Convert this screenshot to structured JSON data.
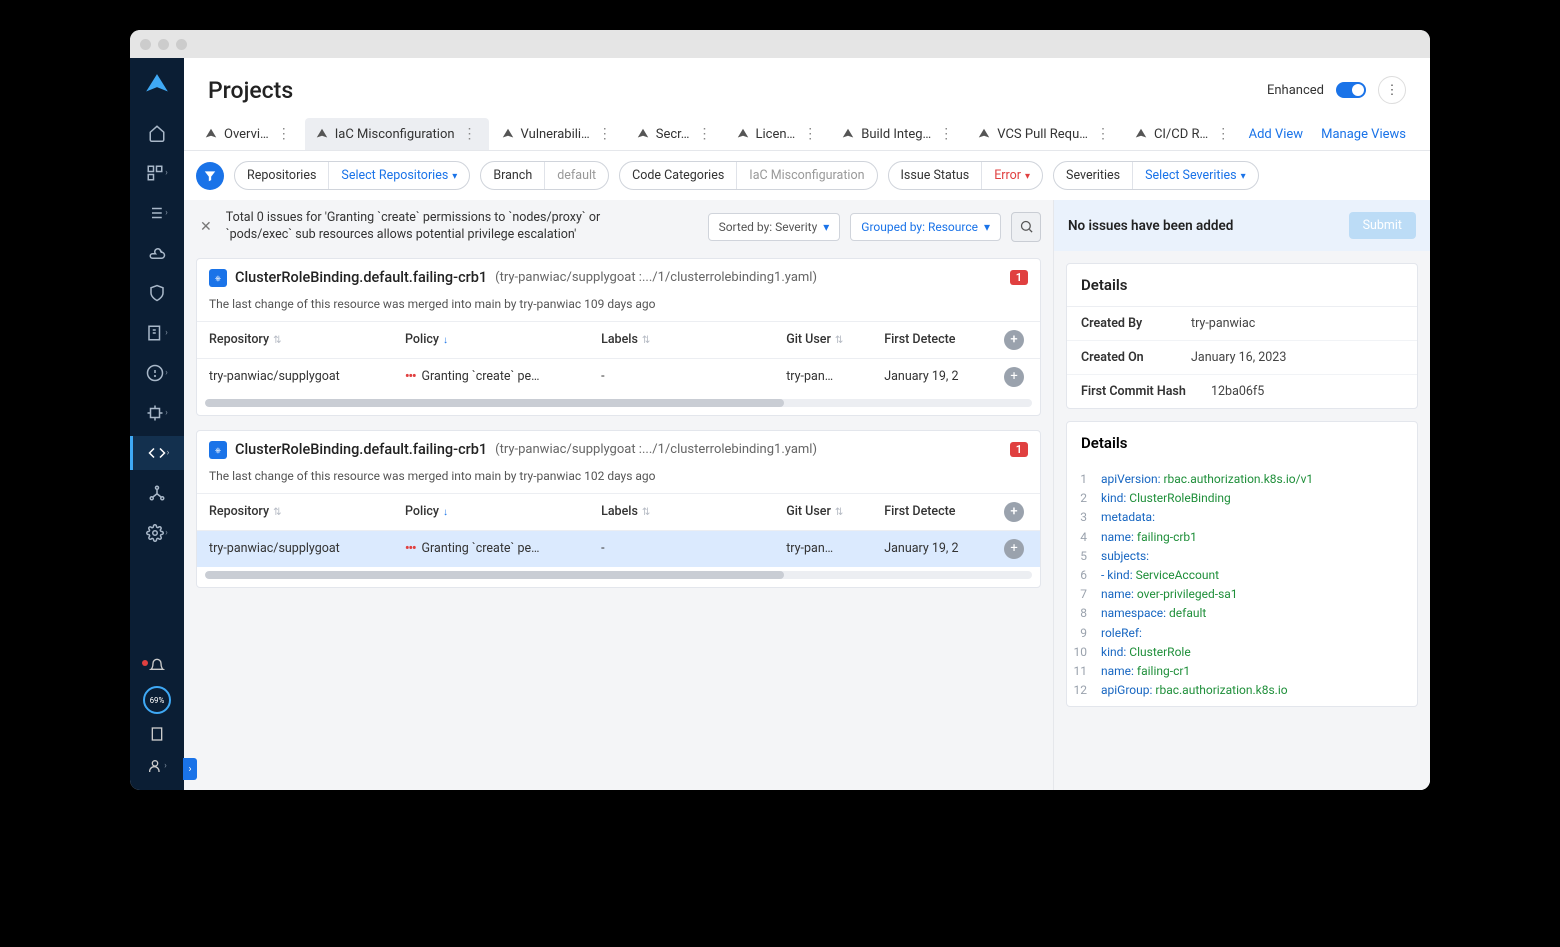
{
  "page": {
    "title": "Projects"
  },
  "header": {
    "enhanced_label": "Enhanced",
    "add_view": "Add View",
    "manage_views": "Manage Views"
  },
  "tabs": [
    {
      "label": "Overvi…",
      "active": false
    },
    {
      "label": "IaC Misconfiguration",
      "active": true
    },
    {
      "label": "Vulnerabili…",
      "active": false
    },
    {
      "label": "Secr…",
      "active": false
    },
    {
      "label": "Licen…",
      "active": false
    },
    {
      "label": "Build Integ…",
      "active": false
    },
    {
      "label": "VCS Pull Requ…",
      "active": false
    },
    {
      "label": "CI/CD R…",
      "active": false
    }
  ],
  "filters": {
    "repos_label": "Repositories",
    "repos_select": "Select Repositories",
    "branch_label": "Branch",
    "branch_value": "default",
    "codecat_label": "Code Categories",
    "codecat_value": "IaC Misconfiguration",
    "status_label": "Issue Status",
    "status_value": "Error",
    "sev_label": "Severities",
    "sev_select": "Select Severities"
  },
  "issues_bar": {
    "summary": "Total 0 issues for 'Granting `create` permissions to `nodes/proxy` or `pods/exec` sub resources allows potential privilege escalation'",
    "sorted_by": "Sorted by: Severity",
    "grouped_by": "Grouped by: Resource"
  },
  "table_headers": {
    "repository": "Repository",
    "policy": "Policy",
    "labels": "Labels",
    "git_user": "Git User",
    "first_detected": "First Detecte"
  },
  "cards": [
    {
      "title": "ClusterRoleBinding.default.failing-crb1",
      "subtitle": "(try-panwiac/supplygoat :.../1/clusterrolebinding1.yaml)",
      "badge": "1",
      "note": "The last change of this resource was merged into main by try-panwiac 109 days ago",
      "row": {
        "repo": "try-panwiac/supplygoat",
        "policy": "Granting `create` pe…",
        "labels": "-",
        "user": "try-pan…",
        "detected": "January 19, 2"
      },
      "highlighted": false
    },
    {
      "title": "ClusterRoleBinding.default.failing-crb1",
      "subtitle": "(try-panwiac/supplygoat :.../1/clusterrolebinding1.yaml)",
      "badge": "1",
      "note": "The last change of this resource was merged into main by try-panwiac 102 days ago",
      "row": {
        "repo": "try-panwiac/supplygoat",
        "policy": "Granting `create` pe…",
        "labels": "-",
        "user": "try-pan…",
        "detected": "January 19, 2"
      },
      "highlighted": true
    }
  ],
  "details": {
    "no_issues": "No issues have been added",
    "submit": "Submit",
    "heading": "Details",
    "created_by_k": "Created By",
    "created_by_v": "try-panwiac",
    "created_on_k": "Created On",
    "created_on_v": "January 16, 2023",
    "hash_k": "First Commit Hash",
    "hash_v": "12ba06f5",
    "code_heading": "Details",
    "code": [
      {
        "n": "1",
        "k": "apiVersion:",
        "v": " rbac.authorization.k8s.io/v1"
      },
      {
        "n": "2",
        "k": "kind:",
        "v": " ClusterRoleBinding"
      },
      {
        "n": "3",
        "k": "metadata:",
        "v": ""
      },
      {
        "n": "4",
        "k": "  name:",
        "v": " failing-crb1"
      },
      {
        "n": "5",
        "k": "subjects:",
        "v": ""
      },
      {
        "n": "6",
        "k": "- kind:",
        "v": " ServiceAccount"
      },
      {
        "n": "7",
        "k": "  name:",
        "v": " over-privileged-sa1"
      },
      {
        "n": "8",
        "k": "  namespace:",
        "v": " default"
      },
      {
        "n": "9",
        "k": "roleRef:",
        "v": ""
      },
      {
        "n": "10",
        "k": "  kind:",
        "v": " ClusterRole"
      },
      {
        "n": "11",
        "k": "  name:",
        "v": " failing-cr1"
      },
      {
        "n": "12",
        "k": "  apiGroup:",
        "v": " rbac.authorization.k8s.io"
      }
    ]
  },
  "gauge": "69%"
}
